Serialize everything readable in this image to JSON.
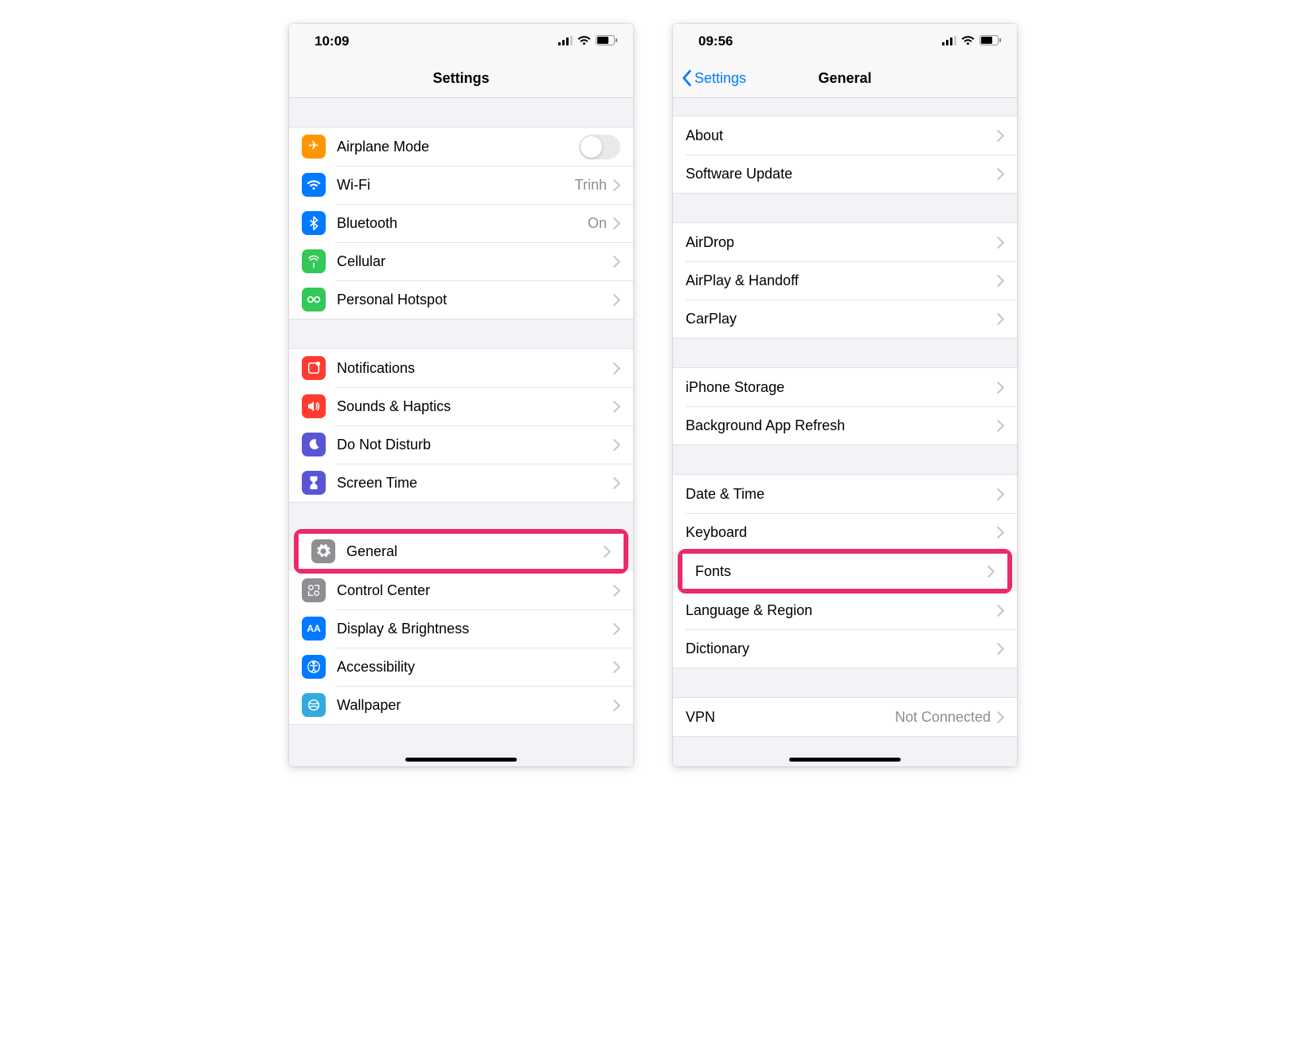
{
  "left": {
    "status_time": "10:09",
    "nav_title": "Settings",
    "groups": [
      {
        "rows": [
          {
            "id": "airplane",
            "icon": "airplane-icon",
            "icon_bg": "bg-orange",
            "label": "Airplane Mode",
            "control": "toggle"
          },
          {
            "id": "wifi",
            "icon": "wifi-icon",
            "icon_bg": "bg-blue",
            "label": "Wi-Fi",
            "value": "Trinh",
            "control": "chevron"
          },
          {
            "id": "bluetooth",
            "icon": "bluetooth-icon",
            "icon_bg": "bg-blue",
            "label": "Bluetooth",
            "value": "On",
            "control": "chevron"
          },
          {
            "id": "cellular",
            "icon": "cellular-icon",
            "icon_bg": "bg-green",
            "label": "Cellular",
            "control": "chevron"
          },
          {
            "id": "hotspot",
            "icon": "hotspot-icon",
            "icon_bg": "bg-green",
            "label": "Personal Hotspot",
            "control": "chevron"
          }
        ]
      },
      {
        "rows": [
          {
            "id": "notifications",
            "icon": "notifications-icon",
            "icon_bg": "bg-red",
            "label": "Notifications",
            "control": "chevron"
          },
          {
            "id": "sounds",
            "icon": "sounds-icon",
            "icon_bg": "bg-red",
            "label": "Sounds & Haptics",
            "control": "chevron"
          },
          {
            "id": "dnd",
            "icon": "dnd-icon",
            "icon_bg": "bg-indigo",
            "label": "Do Not Disturb",
            "control": "chevron"
          },
          {
            "id": "screentime",
            "icon": "screentime-icon",
            "icon_bg": "bg-indigo",
            "label": "Screen Time",
            "control": "chevron"
          }
        ]
      },
      {
        "rows": [
          {
            "id": "general",
            "icon": "gear-icon",
            "icon_bg": "bg-gray",
            "label": "General",
            "control": "chevron",
            "highlighted": true
          },
          {
            "id": "controlcenter",
            "icon": "control-center-icon",
            "icon_bg": "bg-gray",
            "label": "Control Center",
            "control": "chevron"
          },
          {
            "id": "display",
            "icon": "display-icon",
            "icon_bg": "bg-blue",
            "label": "Display & Brightness",
            "control": "chevron"
          },
          {
            "id": "accessibility",
            "icon": "accessibility-icon",
            "icon_bg": "bg-blue",
            "label": "Accessibility",
            "control": "chevron"
          },
          {
            "id": "wallpaper",
            "icon": "wallpaper-icon",
            "icon_bg": "bg-cyan",
            "label": "Wallpaper",
            "control": "chevron"
          }
        ]
      }
    ]
  },
  "right": {
    "status_time": "09:56",
    "nav_back": "Settings",
    "nav_title": "General",
    "groups": [
      {
        "rows": [
          {
            "id": "about",
            "label": "About",
            "control": "chevron"
          },
          {
            "id": "software-update",
            "label": "Software Update",
            "control": "chevron"
          }
        ]
      },
      {
        "rows": [
          {
            "id": "airdrop",
            "label": "AirDrop",
            "control": "chevron"
          },
          {
            "id": "airplay",
            "label": "AirPlay & Handoff",
            "control": "chevron"
          },
          {
            "id": "carplay",
            "label": "CarPlay",
            "control": "chevron"
          }
        ]
      },
      {
        "rows": [
          {
            "id": "iphone-storage",
            "label": "iPhone Storage",
            "control": "chevron"
          },
          {
            "id": "bg-refresh",
            "label": "Background App Refresh",
            "control": "chevron"
          }
        ]
      },
      {
        "rows": [
          {
            "id": "datetime",
            "label": "Date & Time",
            "control": "chevron"
          },
          {
            "id": "keyboard",
            "label": "Keyboard",
            "control": "chevron"
          },
          {
            "id": "fonts",
            "label": "Fonts",
            "control": "chevron",
            "highlighted": true
          },
          {
            "id": "language",
            "label": "Language & Region",
            "control": "chevron"
          },
          {
            "id": "dictionary",
            "label": "Dictionary",
            "control": "chevron"
          }
        ]
      },
      {
        "rows": [
          {
            "id": "vpn",
            "label": "VPN",
            "value": "Not Connected",
            "control": "chevron"
          }
        ]
      }
    ]
  }
}
